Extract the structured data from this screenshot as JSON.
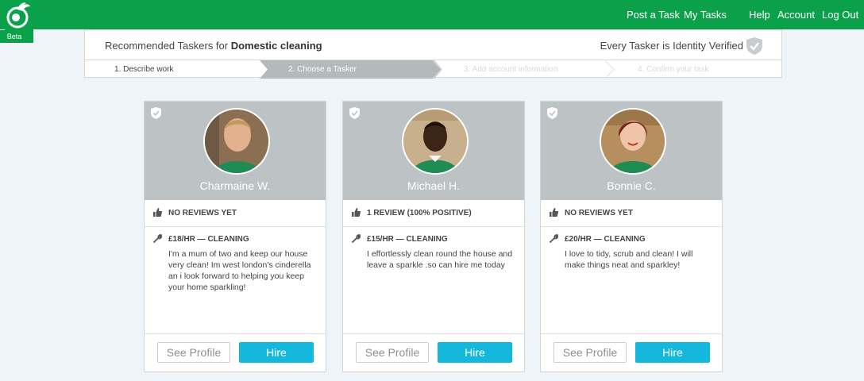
{
  "header": {
    "beta_label": "Beta",
    "nav": {
      "post_task": "Post a Task",
      "my_tasks": "My Tasks",
      "help": "Help",
      "account": "Account",
      "log_out": "Log Out"
    }
  },
  "panel": {
    "title_prefix": "Recommended Taskers for ",
    "title_category": "Domestic cleaning",
    "verified_text": "Every Tasker is Identity Verified",
    "steps": [
      {
        "label": "1. Describe work",
        "state": "done"
      },
      {
        "label": "2. Choose a Tasker",
        "state": "active"
      },
      {
        "label": "3. Add account information",
        "state": "upcoming"
      },
      {
        "label": "4. Confirm your task",
        "state": "upcoming"
      }
    ]
  },
  "taskers": [
    {
      "name": "Charmaine W.",
      "reviews": "NO REVIEWS YET",
      "rate": "£18/HR — CLEANING",
      "bio": "I'm a mum of two and keep our house very clean! Im west london's cinderella an i look forward to helping you keep your home sparkling!",
      "profile_label": "See Profile",
      "hire_label": "Hire"
    },
    {
      "name": "Michael H.",
      "reviews": "1 REVIEW (100% POSITIVE)",
      "rate": "£15/HR — CLEANING",
      "bio": "I effortlessly clean round the house and leave a sparkle .so can hire me today",
      "profile_label": "See Profile",
      "hire_label": "Hire"
    },
    {
      "name": "Bonnie C.",
      "reviews": "NO REVIEWS YET",
      "rate": "£20/HR — CLEANING",
      "bio": "I love to tidy, scrub and clean! I will make things neat and sparkley!",
      "profile_label": "See Profile",
      "hire_label": "Hire"
    }
  ],
  "colors": {
    "brand_green": "#0ba14b",
    "hire_blue": "#14b8dd",
    "card_header": "#bdc3c4",
    "active_step": "#b4b9bb"
  }
}
